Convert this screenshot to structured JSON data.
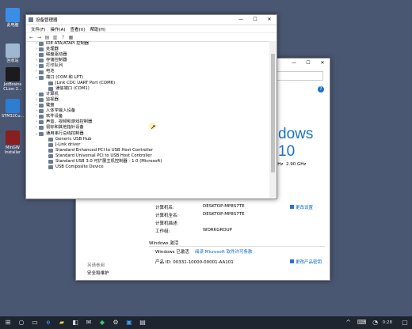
{
  "desktop": {
    "icons": [
      {
        "label": "此电脑",
        "color": "#3a8ee6"
      },
      {
        "label": "回收站",
        "color": "#9fb7d1"
      },
      {
        "label": "JetBrains CLion 2...",
        "color": "#1b1b1b"
      },
      {
        "label": "STM32Cu...",
        "color": "#2d7dd2"
      },
      {
        "label": "MinGW Installer",
        "color": "#8a1f1f"
      }
    ]
  },
  "system_window": {
    "brand_text": "dows 10",
    "cpu_ghz_1": "GHz",
    "cpu_ghz_2": "2.90 GHz",
    "computer_name_label": "计算机名:",
    "computer_name_value": "DESKTOP-MP8S7TE",
    "full_name_label": "计算机全名:",
    "full_name_value": "DESKTOP-MP8S7TE",
    "desc_label": "计算机描述:",
    "workgroup_label": "工作组:",
    "workgroup_value": "WORKGROUP",
    "change_settings": "更改设置",
    "activation_title": "Windows 激活",
    "activation_status": "Windows 已激活",
    "activation_link": "阅读 Microsoft 软件许可条款",
    "product_id": "产品 ID: 00331-10000-00001-AA101",
    "change_key": "更改产品密钥",
    "see_also": "另请参阅",
    "security": "安全和维护"
  },
  "device_manager": {
    "title": "设备管理器",
    "menu": [
      "文件(F)",
      "操作(A)",
      "查看(V)",
      "帮助(H)"
    ],
    "tree": [
      {
        "label": "IDE ATA/ATAPI 控制器",
        "indent": 1,
        "arrow": "›"
      },
      {
        "label": "处理器",
        "indent": 1,
        "arrow": "›"
      },
      {
        "label": "磁盘驱动器",
        "indent": 1,
        "arrow": "›"
      },
      {
        "label": "存储控制器",
        "indent": 1,
        "arrow": "›"
      },
      {
        "label": "打印队列",
        "indent": 1,
        "arrow": "›"
      },
      {
        "label": "电池",
        "indent": 1,
        "arrow": "›"
      },
      {
        "label": "端口 (COM 和 LPT)",
        "indent": 1,
        "arrow": "⌄"
      },
      {
        "label": "JLink CDC UART Port (COM6)",
        "indent": 2,
        "arrow": ""
      },
      {
        "label": "通信端口 (COM1)",
        "indent": 2,
        "arrow": ""
      },
      {
        "label": "计算机",
        "indent": 1,
        "arrow": "›"
      },
      {
        "label": "监视器",
        "indent": 1,
        "arrow": "›"
      },
      {
        "label": "键盘",
        "indent": 1,
        "arrow": "›"
      },
      {
        "label": "人体学输入设备",
        "indent": 1,
        "arrow": "›"
      },
      {
        "label": "软件设备",
        "indent": 1,
        "arrow": "›"
      },
      {
        "label": "声音、视频和游戏控制器",
        "indent": 1,
        "arrow": "›"
      },
      {
        "label": "鼠标和其他指针设备",
        "indent": 1,
        "arrow": "›"
      },
      {
        "label": "通用串行总线控制器",
        "indent": 1,
        "arrow": "⌄"
      },
      {
        "label": "Generic USB Hub",
        "indent": 2,
        "arrow": ""
      },
      {
        "label": "J-Link driver",
        "indent": 2,
        "arrow": ""
      },
      {
        "label": "Standard Enhanced PCI to USB Host Controller",
        "indent": 2,
        "arrow": ""
      },
      {
        "label": "Standard Universal PCI to USB Host Controller",
        "indent": 2,
        "arrow": ""
      },
      {
        "label": "Standard USB 3.0 可扩展主机控制器 - 1.0 (Microsoft)",
        "indent": 2,
        "arrow": ""
      },
      {
        "label": "USB Composite Device",
        "indent": 2,
        "arrow": ""
      }
    ]
  },
  "taskbar": {
    "time": "0:28"
  }
}
